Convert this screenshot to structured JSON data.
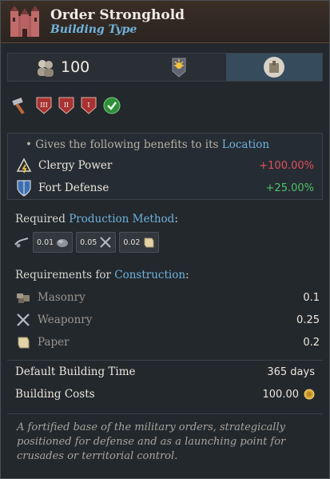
{
  "header": {
    "title": "Order Stronghold",
    "subtitle": "Building Type"
  },
  "tabs": {
    "population": "100"
  },
  "benefits": {
    "intro_prefix": "• Gives the following benefits to its",
    "intro_link": "Location",
    "items": [
      {
        "label": "Clergy Power",
        "value": "+100.00%",
        "icon": "clergy-power-icon"
      },
      {
        "label": "Fort Defense",
        "value": "+25.00%",
        "icon": "shield-icon"
      }
    ]
  },
  "production": {
    "heading_prefix": "Required",
    "heading_link": "Production Method",
    "heading_suffix": ":",
    "chips": [
      {
        "value": "0.01",
        "icon": "iron-icon"
      },
      {
        "value": "0.05",
        "icon": "weaponry-icon"
      },
      {
        "value": "0.02",
        "icon": "paper-icon"
      }
    ]
  },
  "construction": {
    "heading_prefix": "Requirements for",
    "heading_link": "Construction",
    "heading_suffix": ":",
    "items": [
      {
        "label": "Masonry",
        "value": "0.1",
        "icon": "masonry-icon"
      },
      {
        "label": "Weaponry",
        "value": "0.25",
        "icon": "weaponry-icon"
      },
      {
        "label": "Paper",
        "value": "0.2",
        "icon": "paper-icon"
      }
    ]
  },
  "stats": {
    "time_label": "Default Building Time",
    "time_value": "365 days",
    "cost_label": "Building Costs",
    "cost_value": "100.00"
  },
  "description": "A fortified base of the military orders, strategically positioned for defense and as a launching point for crusades or territorial control.",
  "colors": {
    "accent": "#6fb3dc",
    "negative": "#e0505d",
    "positive": "#4ec26b"
  }
}
